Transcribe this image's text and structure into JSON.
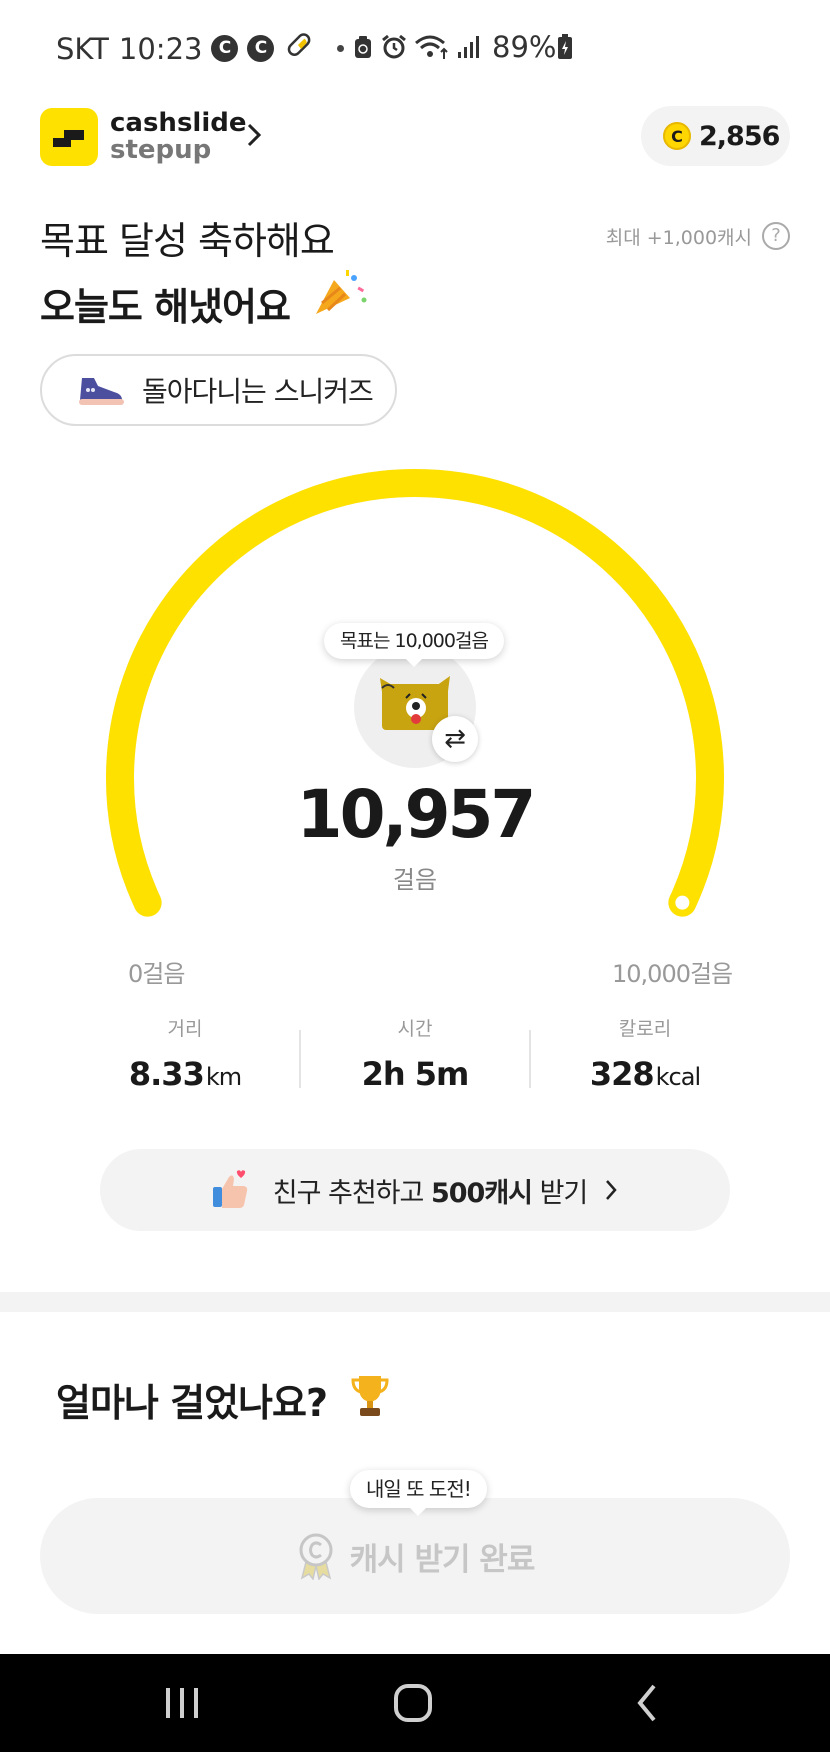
{
  "status_bar": {
    "carrier": "SKT",
    "time": "10:23",
    "notif_c": "C",
    "battery": "89%"
  },
  "header": {
    "logo_line1": "cashslide",
    "logo_line2": "stepup",
    "coin_symbol": "C",
    "cash_amount": "2,856"
  },
  "headline": {
    "line1": "목표 달성 축하해요",
    "line2": "오늘도 해냈어요",
    "max_cash": "최대 +1,000캐시",
    "help": "?"
  },
  "chip": {
    "label": "돌아다니는 스니커즈"
  },
  "gauge": {
    "goal_tooltip": "목표는 10,000걸음",
    "steps": "10,957",
    "unit": "걸음",
    "min_label": "0걸음",
    "max_label": "10,000걸음",
    "progress": 1.0,
    "swap_symbol": "⇄",
    "color": "#ffe100"
  },
  "stats": [
    {
      "label": "거리",
      "value": "8.33",
      "unit": "km"
    },
    {
      "label": "시간",
      "value": "2h 5m",
      "unit": ""
    },
    {
      "label": "칼로리",
      "value": "328",
      "unit": "kcal"
    }
  ],
  "friend_banner": {
    "prefix": "친구 추천하고 ",
    "bold": "500캐시",
    "suffix": " 받기"
  },
  "section": {
    "title": "얼마나 걸었나요?"
  },
  "cash_button": {
    "tooltip": "내일 또 도전!",
    "label": "캐시 받기 완료"
  },
  "icons": {
    "logo": "cashslide-logo-icon",
    "party": "party-popper-icon",
    "sneaker": "sneaker-icon",
    "character": "dog-character-icon",
    "thumbs": "thumbs-up-icon",
    "trophy": "trophy-icon",
    "medal": "medal-icon"
  },
  "colors": {
    "brand_yellow": "#ffe100",
    "pill_bg": "#f3f3f3"
  }
}
